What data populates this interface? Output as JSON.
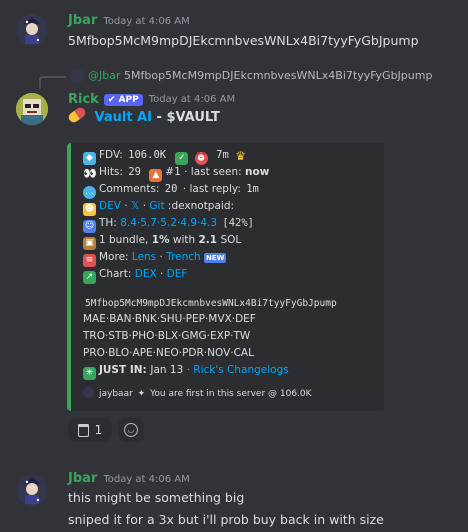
{
  "msg1": {
    "author": "Jbar",
    "timestamp": "Today at 4:06 AM",
    "text": "5Mfbop5McM9mpDJEkcmnbvesWNLx4Bi7tyyFyGbJpump",
    "author_color": "#3ba55c"
  },
  "reply": {
    "author": "@Jbar",
    "text": "5Mfbop5McM9mpDJEkcmnbvesWNLx4Bi7tyyFyGbJpump"
  },
  "msg2": {
    "author": "Rick",
    "app_badge": "APP",
    "timestamp": "Today at 4:06 AM",
    "title_link": "Vault AI",
    "title_rest": " - $VAULT",
    "author_color": "#3ba55c"
  },
  "embed": {
    "fdv_label": "FDV: ",
    "fdv_value": "106.0K",
    "age_value": "7m",
    "hits_label": "Hits: ",
    "hits_value": "29",
    "rank": "#1",
    "last_seen_label": " · last seen: ",
    "last_seen_value": "now",
    "comments_label": "Comments: ",
    "comments_value": "20",
    "last_reply_label": " · last reply: ",
    "last_reply_value": "1m",
    "dev_link": "DEV",
    "x_link": "𝕏",
    "git_link": "Git",
    "dev_rest": ":dexnotpaid:",
    "th_label": "TH: ",
    "th_values": "8.4·5.7·5.2·4.9·4.3",
    "th_pct": "[42%]",
    "bundle_text": "1 bundle, ",
    "bundle_pct": "1%",
    "bundle_with": " with ",
    "bundle_sol": "2.1",
    "bundle_sol_unit": " SOL",
    "more_label": "More: ",
    "more_lens": "Lens",
    "more_trench": "Trench",
    "new_badge": "NEW",
    "chart_label": "Chart: ",
    "chart_dex": "DEX",
    "chart_def": "DEF",
    "contract": "5Mfbop5McM9mpDJEkcmnbvesWNLx4Bi7tyyFyGbJpump",
    "links_row1": "MAE·BAN·BNK·SHU·PEP·MVX·DEF",
    "links_row2": "TRO·STB·PHO·BLX·GMG·EXP·TW",
    "links_row3": "PRO·BLO·APE·NEO·PDR·NOV·CAL",
    "justin_label": "JUST IN: ",
    "justin_date": "Jan 13",
    "changelog": "Rick's Changelogs",
    "footer_user": "jaybaar",
    "footer_text": "You are first in this server @ 106.0K"
  },
  "reactions": [
    {
      "icon": "trash-can-emoji",
      "count": "1"
    },
    {
      "icon": "add-reaction-icon",
      "count": ""
    }
  ],
  "msg3": {
    "author": "Jbar",
    "timestamp": "Today at 4:06 AM",
    "line1": "this might be something big",
    "line2": "sniped it for a 3x but i'll prob buy back in with size"
  },
  "colors": {
    "background": "#313338",
    "embed_bg": "#2b2d31",
    "embed_border": "#3ba55c",
    "link": "#00a8fc",
    "app_badge": "#5865f2"
  }
}
